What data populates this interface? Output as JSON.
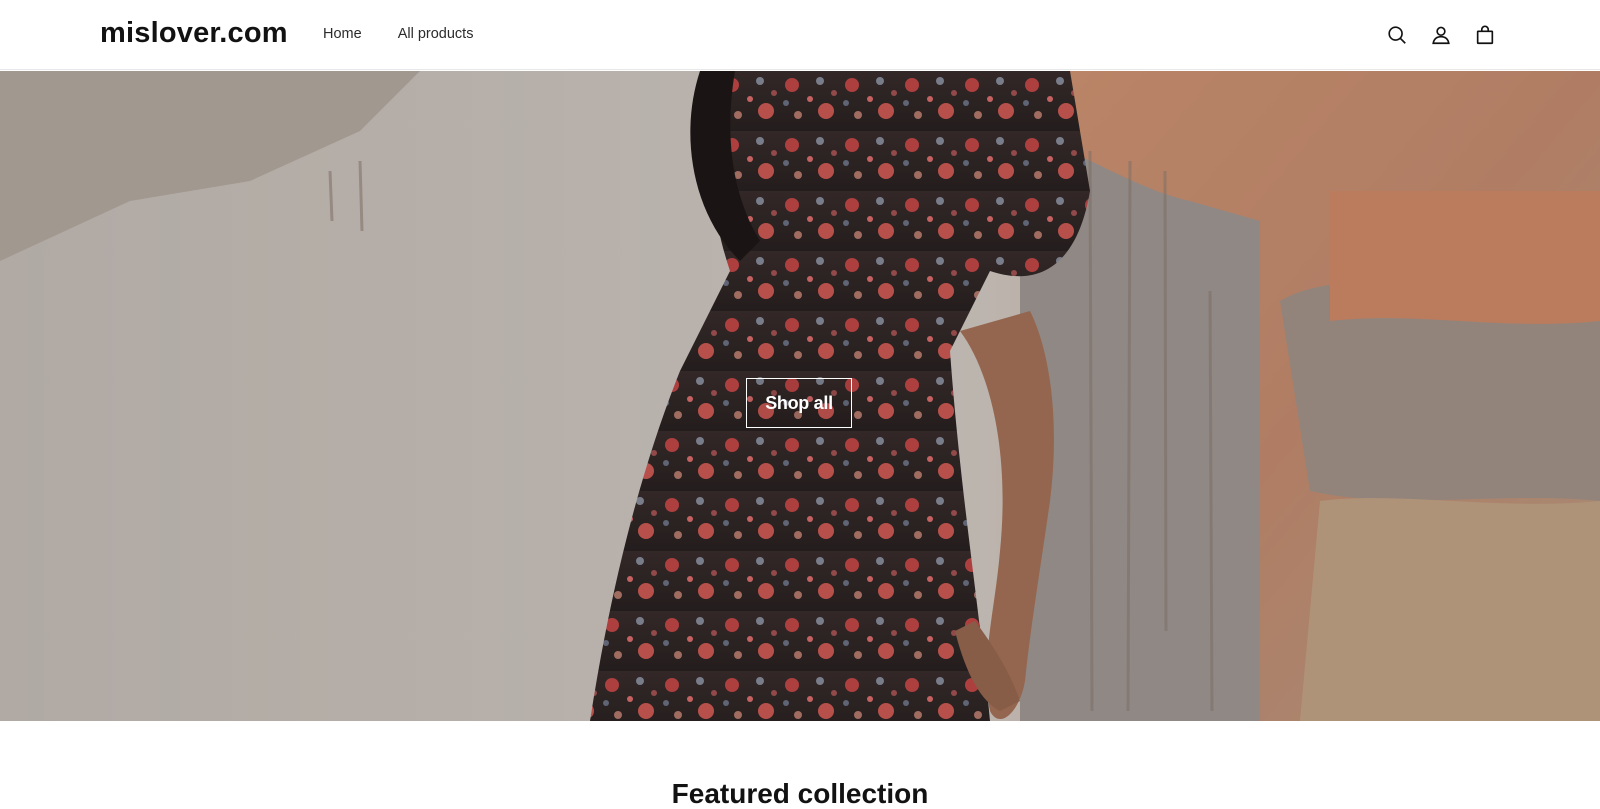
{
  "header": {
    "logo": "mislover.com",
    "nav": [
      "Home",
      "All products"
    ],
    "icons": [
      "search-icon",
      "account-icon",
      "cart-icon"
    ]
  },
  "hero": {
    "button_label": "Shop all"
  },
  "featured": {
    "title": "Featured collection"
  }
}
